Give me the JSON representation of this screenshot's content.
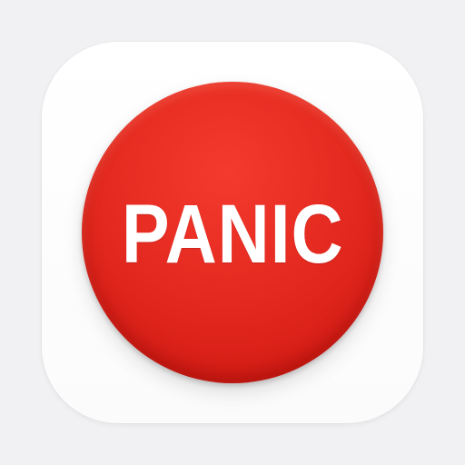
{
  "button": {
    "label": "PANIC",
    "color": "#e52b21",
    "text_color": "#ffffff"
  },
  "tile": {
    "background": "#ffffff"
  }
}
